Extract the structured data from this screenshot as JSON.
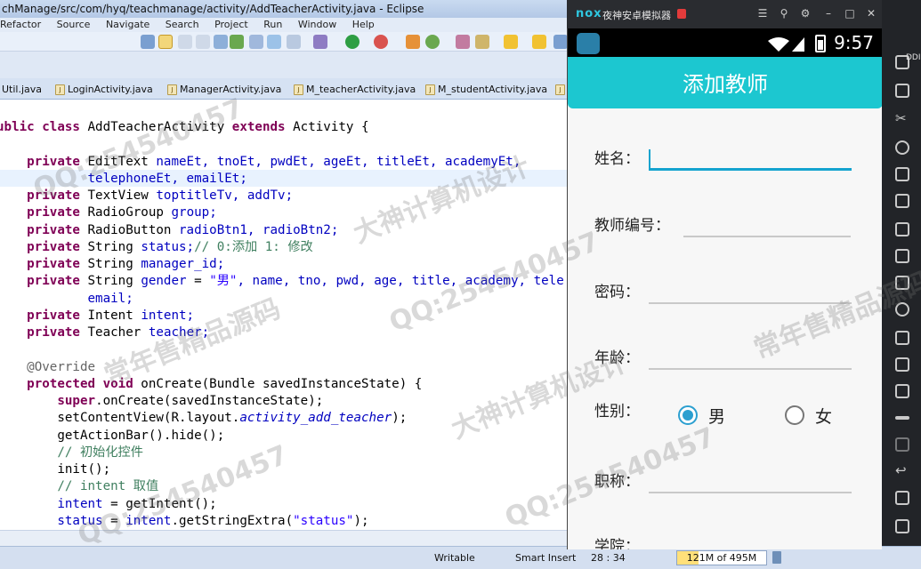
{
  "eclipse": {
    "title": "chManage/src/com/hyq/teachmanage/activity/AddTeacherActivity.java - Eclipse",
    "menu": [
      "Refactor",
      "Source",
      "Navigate",
      "Search",
      "Project",
      "Run",
      "Window",
      "Help"
    ],
    "tabs": [
      "Util.java",
      "LoginActivity.java",
      "ManagerActivity.java",
      "M_teacherActivity.java",
      "M_studentActivity.java"
    ],
    "status": {
      "writable": "Writable",
      "insert_mode": "Smart Insert",
      "position": "28 : 34",
      "memory": "121M of 495M",
      "memory_fraction": 0.244
    }
  },
  "code": {
    "l1": {
      "a": "ublic class ",
      "b": "AddTeacherActivity ",
      "c": "extends ",
      "d": "Activity {"
    },
    "l2": {
      "kw": "private ",
      "type": "EditText ",
      "f": "nameEt, tnoEt, pwdEt, ageEt, titleEt, academyEt,"
    },
    "l3": {
      "f": "telephoneEt, emailEt;"
    },
    "l4": {
      "kw": "private ",
      "type": "TextView ",
      "f": "toptitleTv, addTv;"
    },
    "l5": {
      "kw": "private ",
      "type": "RadioGroup ",
      "f": "group;"
    },
    "l6": {
      "kw": "private ",
      "type": "RadioButton ",
      "f": "radioBtn1, radioBtn2;"
    },
    "l7": {
      "kw": "private ",
      "type": "String ",
      "f": "status;",
      "cm": "// 0:添加 1: 修改"
    },
    "l8": {
      "kw": "private ",
      "type": "String ",
      "f": "manager_id;"
    },
    "l9": {
      "kw": "private ",
      "type": "String ",
      "f": "gender",
      "eq": " = ",
      "s": "\"男\"",
      "rest": ", name, tno, pwd, age, title, academy, tele"
    },
    "l10": {
      "f": "email;"
    },
    "l11": {
      "kw": "private ",
      "type": "Intent ",
      "f": "intent;"
    },
    "l12": {
      "kw": "private ",
      "type": "Teacher ",
      "f": "teacher;"
    },
    "l13": {
      "ann": "@Override"
    },
    "l14": {
      "kw": "protected void ",
      "rest": "onCreate(Bundle savedInstanceState) {"
    },
    "l15": {
      "kw": "super",
      "rest": ".onCreate(savedInstanceState);"
    },
    "l16": {
      "a": "setContentView(R.layout.",
      "it": "activity_add_teacher",
      "b": ");"
    },
    "l17": {
      "a": "getActionBar().hide();"
    },
    "l18": {
      "cm": "// 初始化控件"
    },
    "l19": {
      "a": "init();"
    },
    "l20": {
      "cm": "// intent 取值"
    },
    "l21": {
      "f": "intent",
      "rest": " = getIntent();"
    },
    "l22": {
      "f": "status",
      "rest": " = ",
      "f2": "intent",
      "rest2": ".getStringExtra(",
      "s": "\"status\"",
      "end": ");"
    }
  },
  "nox": {
    "brand": "nox",
    "window_title": "夜神安卓模拟器",
    "time": "9:57",
    "side_top": "DDI"
  },
  "app": {
    "title": "添加教师",
    "labels": {
      "name": "姓名：",
      "tno": "教师编号：",
      "pwd": "密码：",
      "age": "年龄：",
      "gender": "性别：",
      "title": "职称：",
      "academy": "学院："
    },
    "radio_male": "男",
    "radio_female": "女",
    "gender_selected": "男"
  },
  "watermark": {
    "qq": "QQ:254540457",
    "a": "常年售精品源码",
    "b": "大神计算机设计"
  }
}
